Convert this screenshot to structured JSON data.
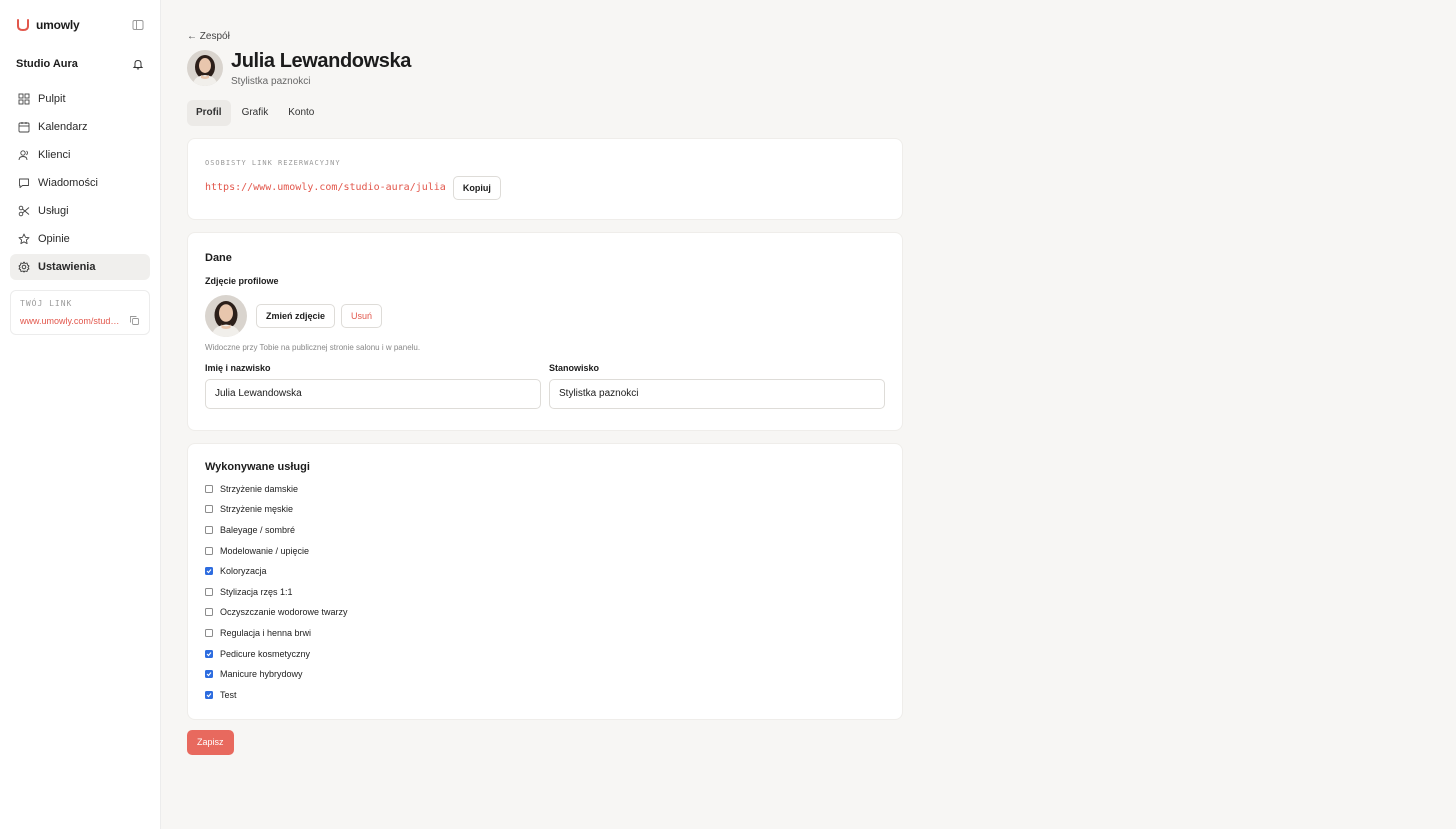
{
  "brand": {
    "name": "umowly",
    "accent": "#e2574c"
  },
  "org": {
    "name": "Studio Aura"
  },
  "sidebar": {
    "items": [
      {
        "label": "Pulpit",
        "icon": "dashboard-icon"
      },
      {
        "label": "Kalendarz",
        "icon": "calendar-icon"
      },
      {
        "label": "Klienci",
        "icon": "users-icon"
      },
      {
        "label": "Wiadomości",
        "icon": "message-icon"
      },
      {
        "label": "Usługi",
        "icon": "scissors-icon"
      },
      {
        "label": "Opinie",
        "icon": "star-icon"
      },
      {
        "label": "Ustawienia",
        "icon": "gear-icon",
        "active": true
      }
    ],
    "link_box": {
      "title": "TWÓJ LINK",
      "url": "www.umowly.com/studio…"
    }
  },
  "header": {
    "back_label": "← Zespół",
    "name": "Julia Lewandowska",
    "role": "Stylistka paznokci"
  },
  "tabs": [
    {
      "label": "Profil",
      "active": true
    },
    {
      "label": "Grafik"
    },
    {
      "label": "Konto"
    }
  ],
  "booking": {
    "caption": "OSOBISTY LINK REZERWACYJNY",
    "url": "https://www.umowly.com/studio-aura/julia",
    "copy_label": "Kopiuj"
  },
  "data_section": {
    "title": "Dane",
    "photo_label": "Zdjęcie profilowe",
    "change_photo": "Zmień zdjęcie",
    "remove_photo": "Usuń",
    "hint": "Widoczne przy Tobie na publicznej stronie salonu i w panelu.",
    "name_label": "Imię i nazwisko",
    "name_value": "Julia Lewandowska",
    "role_label": "Stanowisko",
    "role_value": "Stylistka paznokci"
  },
  "services": {
    "title": "Wykonywane usługi",
    "items": [
      {
        "label": "Strzyżenie damskie",
        "checked": false
      },
      {
        "label": "Strzyżenie męskie",
        "checked": false
      },
      {
        "label": "Baleyage / sombré",
        "checked": false
      },
      {
        "label": "Modelowanie / upięcie",
        "checked": false
      },
      {
        "label": "Koloryzacja",
        "checked": true
      },
      {
        "label": "Stylizacja rzęs 1:1",
        "checked": false
      },
      {
        "label": "Oczyszczanie wodorowe twarzy",
        "checked": false
      },
      {
        "label": "Regulacja i henna brwi",
        "checked": false
      },
      {
        "label": "Pedicure kosmetyczny",
        "checked": true
      },
      {
        "label": "Manicure hybrydowy",
        "checked": true
      },
      {
        "label": "Test",
        "checked": true
      }
    ]
  },
  "save_label": "Zapisz"
}
